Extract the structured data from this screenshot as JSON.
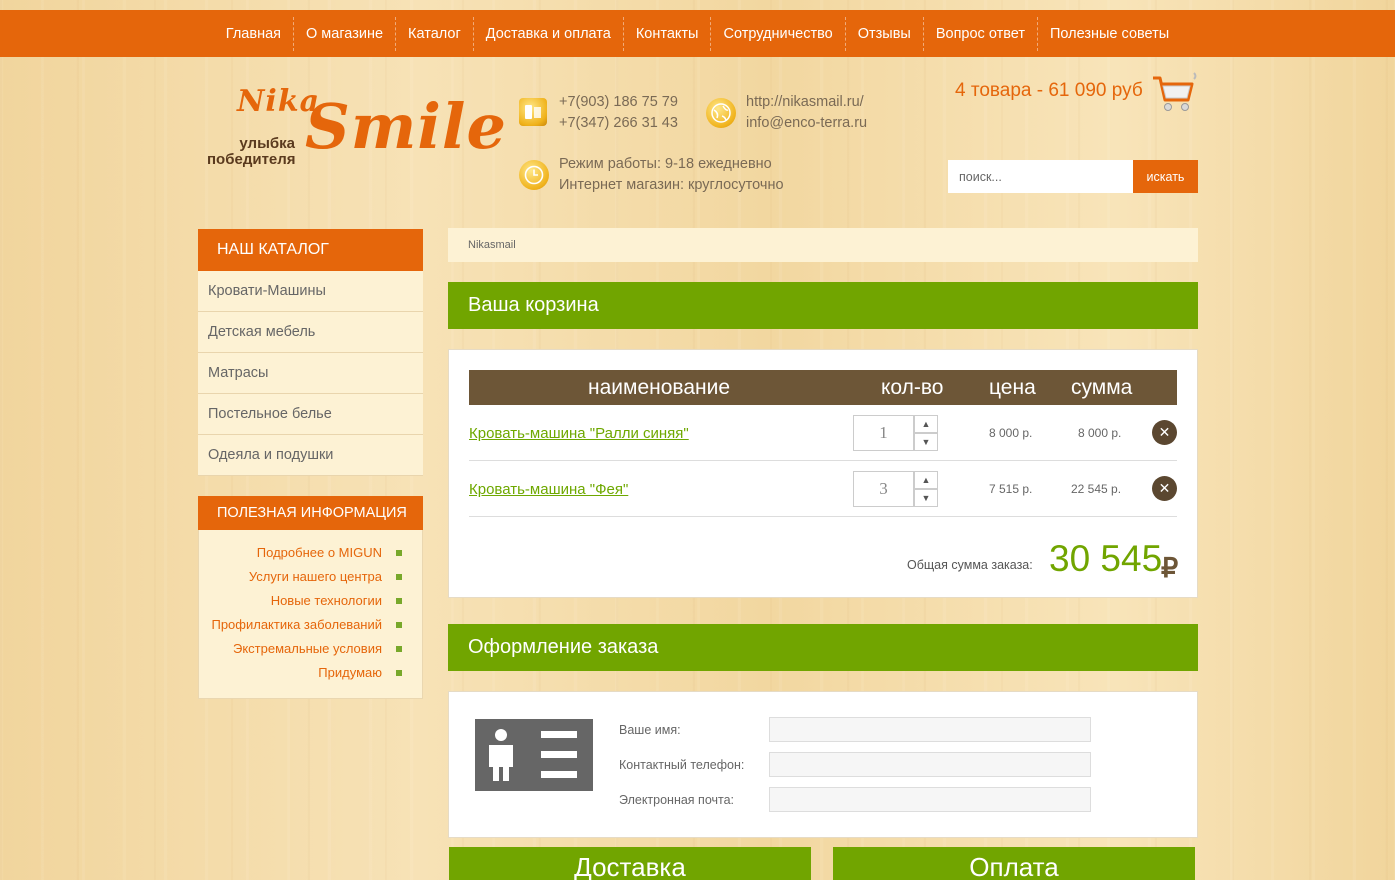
{
  "nav": {
    "items": [
      "Главная",
      "О магазине",
      "Каталог",
      "Доставка и оплата",
      "Контакты",
      "Сотрудничество",
      "Отзывы",
      "Вопрос ответ",
      "Полезные советы"
    ]
  },
  "logo": {
    "top": "Nika",
    "main": "Smile",
    "tagline": "улыбка победителя"
  },
  "contacts": {
    "phone1": "+7(903) 186 75 79",
    "phone2": "+7(347) 266 31 43",
    "site": "http://nikasmail.ru/",
    "email": "info@enco-terra.ru",
    "hours1": "Режим работы: 9-18 ежедневно",
    "hours2": "Интернет магазин: круглосуточно"
  },
  "cart_summary": "4 товара - 61 090 руб",
  "search": {
    "placeholder": "поиск...",
    "button": "искать"
  },
  "catalog": {
    "title": "НАШ КАТАЛОГ",
    "items": [
      "Кровати-Машины",
      "Детская мебель",
      "Матрасы",
      "Постельное белье",
      "Одеяла и подушки"
    ]
  },
  "info": {
    "title": "ПОЛЕЗНАЯ ИНФОРМАЦИЯ",
    "items": [
      "Подробнее о MIGUN",
      "Услуги нашего центра",
      "Новые технологии",
      "Профилактика заболеваний",
      "Экстремальные условия",
      "Придумаю"
    ]
  },
  "breadcrumb": "Nikasmail",
  "cart": {
    "title": "Ваша корзина",
    "columns": {
      "name": "наименование",
      "qty": "кол-во",
      "price": "цена",
      "sum": "сумма"
    },
    "rows": [
      {
        "name": "Кровать-машина \"Ралли синяя\"",
        "qty": "1",
        "price": "8 000 р.",
        "sum": "8 000 р."
      },
      {
        "name": "Кровать-машина \"Фея\"",
        "qty": "3",
        "price": "7 515 р.",
        "sum": "22 545 р."
      }
    ],
    "total_label": "Общая сумма заказа:",
    "total_value": "30 545",
    "currency": "₽"
  },
  "order": {
    "title": "Оформление заказа",
    "fields": [
      {
        "label": "Ваше имя:",
        "value": ""
      },
      {
        "label": "Контактный телефон:",
        "value": ""
      },
      {
        "label": "Электронная почта:",
        "value": ""
      }
    ]
  },
  "delivery_title": "Доставка",
  "payment_title": "Оплата",
  "icons": {
    "phone": "phone-icon",
    "globe": "globe-icon",
    "clock": "clock-icon",
    "cart": "cart-icon",
    "remove": "close-icon",
    "spin_up": "chevron-up-icon",
    "spin_down": "chevron-down-icon",
    "contact_card": "contact-card-icon"
  },
  "colors": {
    "accent_orange": "#e5660b",
    "accent_green": "#71a500",
    "table_head": "#6d5637"
  }
}
